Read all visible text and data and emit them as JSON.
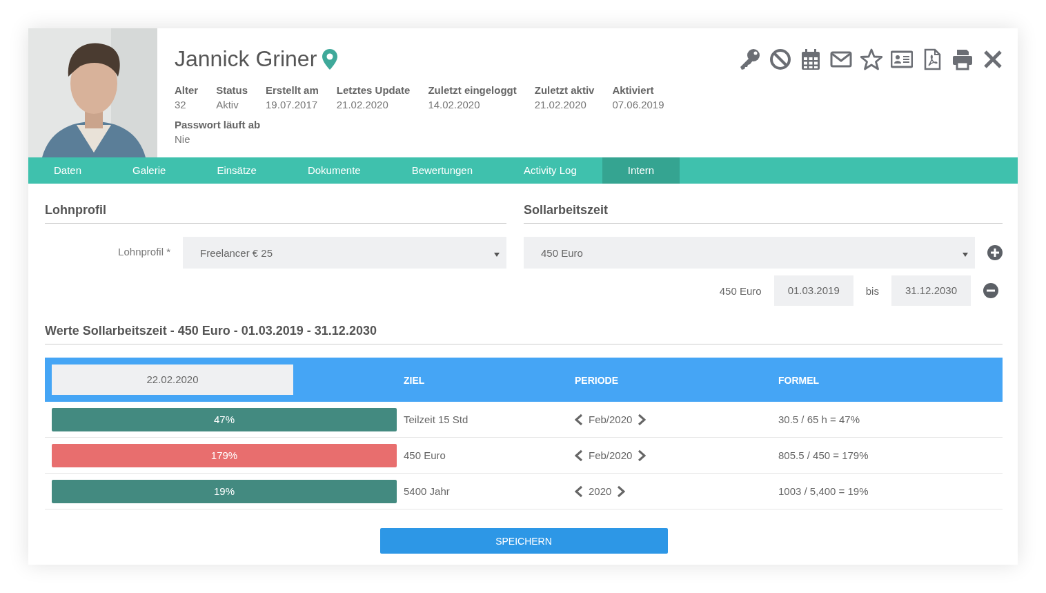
{
  "profile": {
    "name": "Jannick Griner",
    "facts": [
      {
        "label": "Alter",
        "value": "32"
      },
      {
        "label": "Status",
        "value": "Aktiv"
      },
      {
        "label": "Erstellt am",
        "value": "19.07.2017"
      },
      {
        "label": "Letztes Update",
        "value": "21.02.2020"
      },
      {
        "label": "Zuletzt eingeloggt",
        "value": "14.02.2020"
      },
      {
        "label": "Zuletzt aktiv",
        "value": "21.02.2020"
      },
      {
        "label": "Aktiviert",
        "value": "07.06.2019"
      }
    ],
    "facts_2": [
      {
        "label": "Passwort läuft ab",
        "value": "Nie"
      }
    ],
    "actions": [
      {
        "kind": "key"
      },
      {
        "kind": "block"
      },
      {
        "kind": "calendar"
      },
      {
        "kind": "mail"
      },
      {
        "kind": "star"
      },
      {
        "kind": "card"
      },
      {
        "kind": "pdf"
      },
      {
        "kind": "print"
      },
      {
        "kind": "close"
      }
    ]
  },
  "tabs": [
    {
      "label": "Daten",
      "selected": false
    },
    {
      "label": "Galerie",
      "selected": false
    },
    {
      "label": "Einsätze",
      "selected": false
    },
    {
      "label": "Dokumente",
      "selected": false
    },
    {
      "label": "Bewertungen",
      "selected": false
    },
    {
      "label": "Activity Log",
      "selected": false
    },
    {
      "label": "Intern",
      "selected": true
    }
  ],
  "lohnprofil": {
    "title": "Lohnprofil",
    "label": "Lohnprofil *",
    "value": "Freelancer € 25"
  },
  "sollarbeitszeit": {
    "title": "Sollarbeitszeit",
    "value": "450 Euro",
    "entry": {
      "name": "450 Euro",
      "from": "01.03.2019",
      "separator": "bis",
      "to": "31.12.2030"
    }
  },
  "werte": {
    "title": "Werte Sollarbeitszeit - 450 Euro - 01.03.2019 - 31.12.2030",
    "date": "22.02.2020",
    "columns": [
      "ZIEL",
      "PERIODE",
      "FORMEL"
    ],
    "rows": [
      {
        "percent": "47%",
        "color": "#438a80",
        "ziel": "Teilzeit 15 Std",
        "periode": "Feb/2020",
        "formel": "30.5 / 65 h = 47%"
      },
      {
        "percent": "179%",
        "color": "#e86e6e",
        "ziel": "450 Euro",
        "periode": "Feb/2020",
        "formel": "805.5 / 450 = 179%"
      },
      {
        "percent": "19%",
        "color": "#438a80",
        "ziel": "5400 Jahr",
        "periode": "2020",
        "formel": "1003 / 5,400 = 19%"
      }
    ]
  },
  "save_button": "SPEICHERN"
}
